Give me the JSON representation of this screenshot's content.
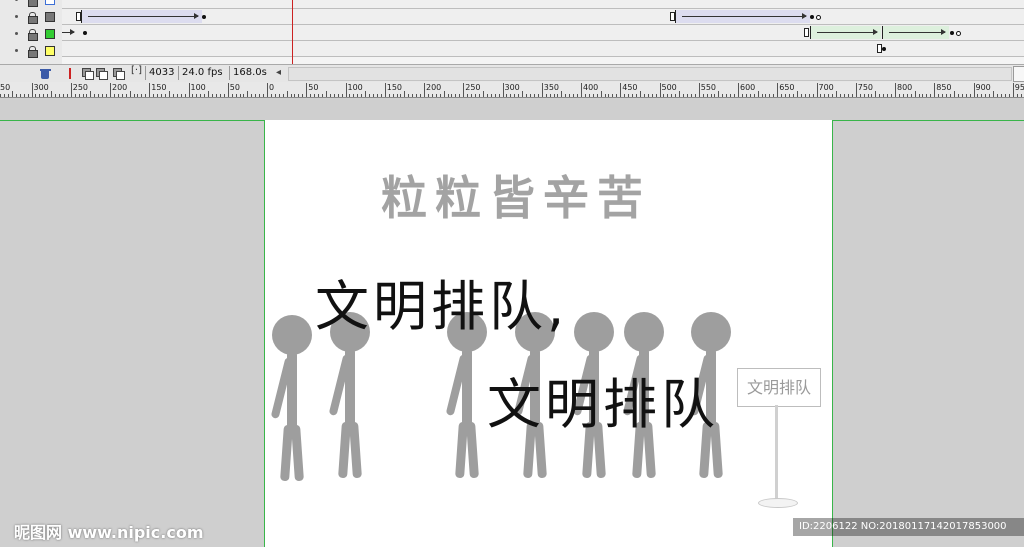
{
  "timeline": {
    "layers": [
      {
        "color": "#3d6fd6"
      },
      {
        "color": "#777777"
      },
      {
        "color": "#33cc33"
      },
      {
        "color": "#ffff66"
      }
    ],
    "status": {
      "frame": "4033",
      "fps": "24.0 fps",
      "elapsed": "168.0s"
    }
  },
  "ruler": {
    "labels": [
      "50",
      "300",
      "250",
      "200",
      "150",
      "100",
      "50",
      "0",
      "50",
      "100",
      "150",
      "200",
      "250",
      "300",
      "350",
      "400",
      "450",
      "500",
      "550",
      "600",
      "650",
      "700",
      "750",
      "800",
      "850",
      "900",
      "95"
    ]
  },
  "stage": {
    "subtitle": "粒粒皆辛苦",
    "slogan_line1": "文明排队,",
    "slogan_line2": "文明排队",
    "sign_text": "文明排队",
    "figure_color": "#9e9e9e"
  },
  "watermark": {
    "left": "昵图网 www.nipic.com",
    "right": "ID:2206122 NO:20180117142017853000"
  },
  "colors": {
    "guide": "#39b54a",
    "playhead": "#cc2222"
  }
}
